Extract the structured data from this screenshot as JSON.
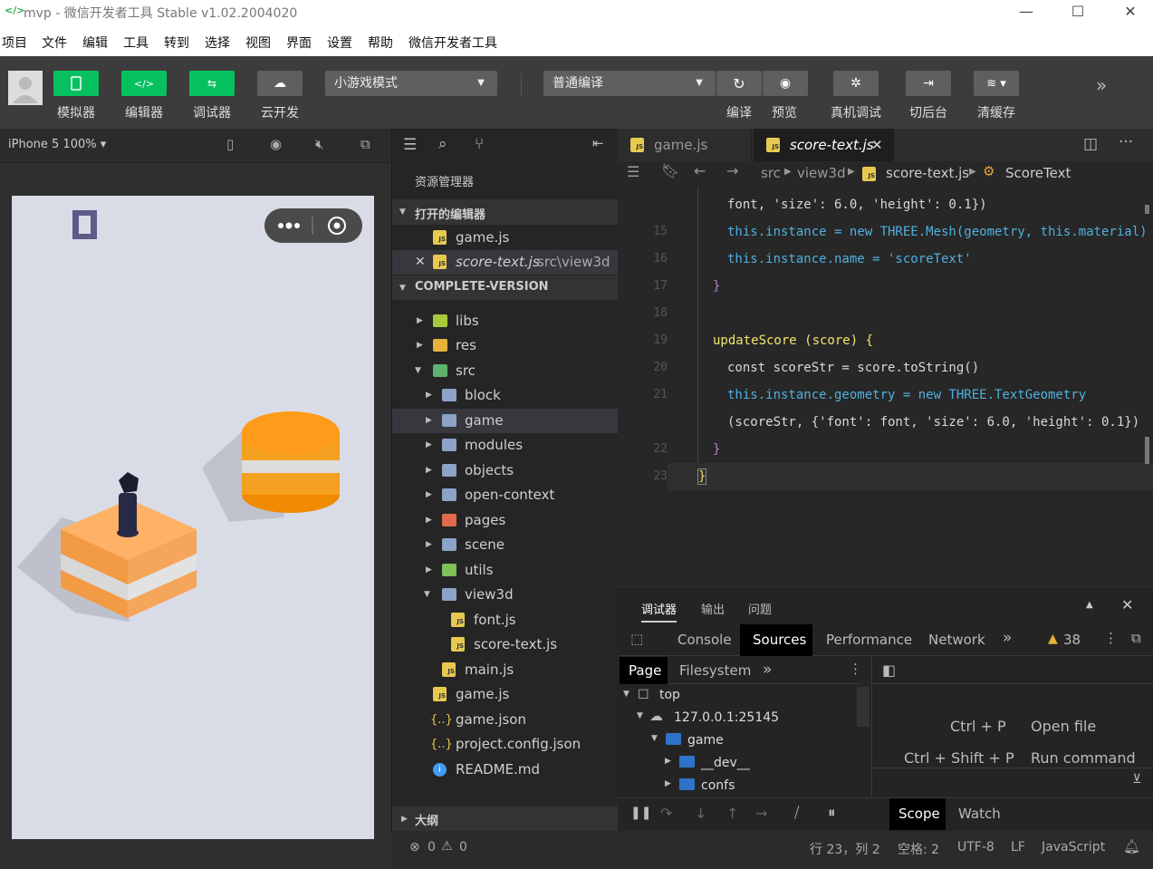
{
  "window": {
    "title": "mvp - 微信开发者工具 Stable v1.02.2004020"
  },
  "menu": [
    "项目",
    "文件",
    "编辑",
    "工具",
    "转到",
    "选择",
    "视图",
    "界面",
    "设置",
    "帮助",
    "微信开发者工具"
  ],
  "toolbar": {
    "simulator": "模拟器",
    "editor": "编辑器",
    "debugger": "调试器",
    "cloud": "云开发",
    "mode_select": "小游戏模式",
    "compile_select": "普通编译",
    "compile": "编译",
    "preview": "预览",
    "real_debug": "真机调试",
    "background": "切后台",
    "clear_cache": "清缓存"
  },
  "simulator": {
    "device": "iPhone 5 100% ▾"
  },
  "explorer": {
    "title": "资源管理器",
    "open_editors_label": "打开的编辑器",
    "open_editors": [
      {
        "name": "game.js",
        "path": ""
      },
      {
        "name": "score-text.js",
        "path": "src\\view3d"
      }
    ],
    "project_label": "COMPLETE-VERSION",
    "tree": [
      "libs",
      "res",
      "src",
      "block",
      "game",
      "modules",
      "objects",
      "open-context",
      "pages",
      "scene",
      "utils",
      "view3d",
      "font.js",
      "score-text.js",
      "main.js",
      "game.js",
      "game.json",
      "project.config.json",
      "README.md"
    ],
    "outline_label": "大纲"
  },
  "editor": {
    "tabs": [
      "game.js",
      "score-text.js"
    ],
    "breadcrumb": [
      "src",
      "view3d",
      "score-text.js",
      "ScoreText"
    ],
    "line_numbers": [
      "15",
      "16",
      "17",
      "18",
      "19",
      "20",
      "21",
      "22",
      "23"
    ],
    "code": {
      "l0": "font, 'size': 6.0, 'height': 0.1})",
      "l15": "this.instance = new THREE.Mesh(geometry, this.material)",
      "l16": "this.instance.name = 'scoreText'",
      "l17": "}",
      "l19": "updateScore (score) {",
      "l20": "const scoreStr = score.toString()",
      "l21": "this.instance.geometry = new THREE.TextGeometry",
      "l21b": "(scoreStr, {'font': font, 'size': 6.0, 'height': 0.1})",
      "l22": "}",
      "l23": "}"
    }
  },
  "debugger": {
    "panel_tabs": [
      "调试器",
      "输出",
      "问题"
    ],
    "devtools_tabs": [
      "Console",
      "Sources",
      "Performance",
      "Network"
    ],
    "warnings": "38",
    "nav_tabs": [
      "Page",
      "Filesystem"
    ],
    "tree": [
      "top",
      "127.0.0.1:25145",
      "game",
      "__dev__",
      "confs"
    ],
    "shortcuts": [
      {
        "key": "Ctrl + P",
        "action": "Open file"
      },
      {
        "key": "Ctrl + Shift + P",
        "action": "Run command"
      }
    ],
    "scope_tabs": [
      "Scope",
      "Watch"
    ]
  },
  "status": {
    "errors": "0",
    "warnings": "0",
    "position": "行 23，列 2",
    "indent": "空格: 2",
    "encoding": "UTF-8",
    "eol": "LF",
    "language": "JavaScript"
  }
}
